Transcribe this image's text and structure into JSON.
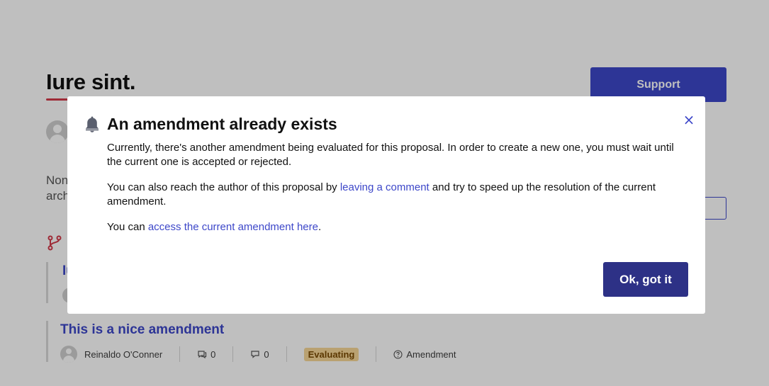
{
  "page": {
    "title": "Iure sint.",
    "support_label": "Support",
    "body_excerpt": "Non arch",
    "amendments": [
      {
        "title": "Iu"
      },
      {
        "title": "This is a nice amendment",
        "author": "Reinaldo O'Conner",
        "comments_count": "0",
        "endorsements_count": "0",
        "status": "Evaluating",
        "type": "Amendment"
      }
    ]
  },
  "modal": {
    "title": "An amendment already exists",
    "close_label": "×",
    "para1": "Currently, there's another amendment being evaluated for this proposal. In order to create a new one, you must wait until the current one is accepted or rejected.",
    "para2_before": "You can also reach the author of this proposal by ",
    "para2_link": "leaving a comment",
    "para2_after": " and try to speed up the resolution of the current amendment.",
    "para3_before": "You can ",
    "para3_link": "access the current amendment here",
    "para3_after": ".",
    "ok_label": "Ok, got it"
  },
  "colors": {
    "primary": "#3d47c9",
    "primary_dark": "#2d3186",
    "accent_underline": "#d33a4a",
    "badge_bg": "#f7d797",
    "overlay": "rgba(0,0,0,0.25)"
  },
  "icons": {
    "bell": "bell-icon",
    "close": "close-icon",
    "branch": "branch-icon",
    "comment": "comment-icon",
    "endorse": "endorse-icon",
    "help": "help-circle-icon"
  }
}
